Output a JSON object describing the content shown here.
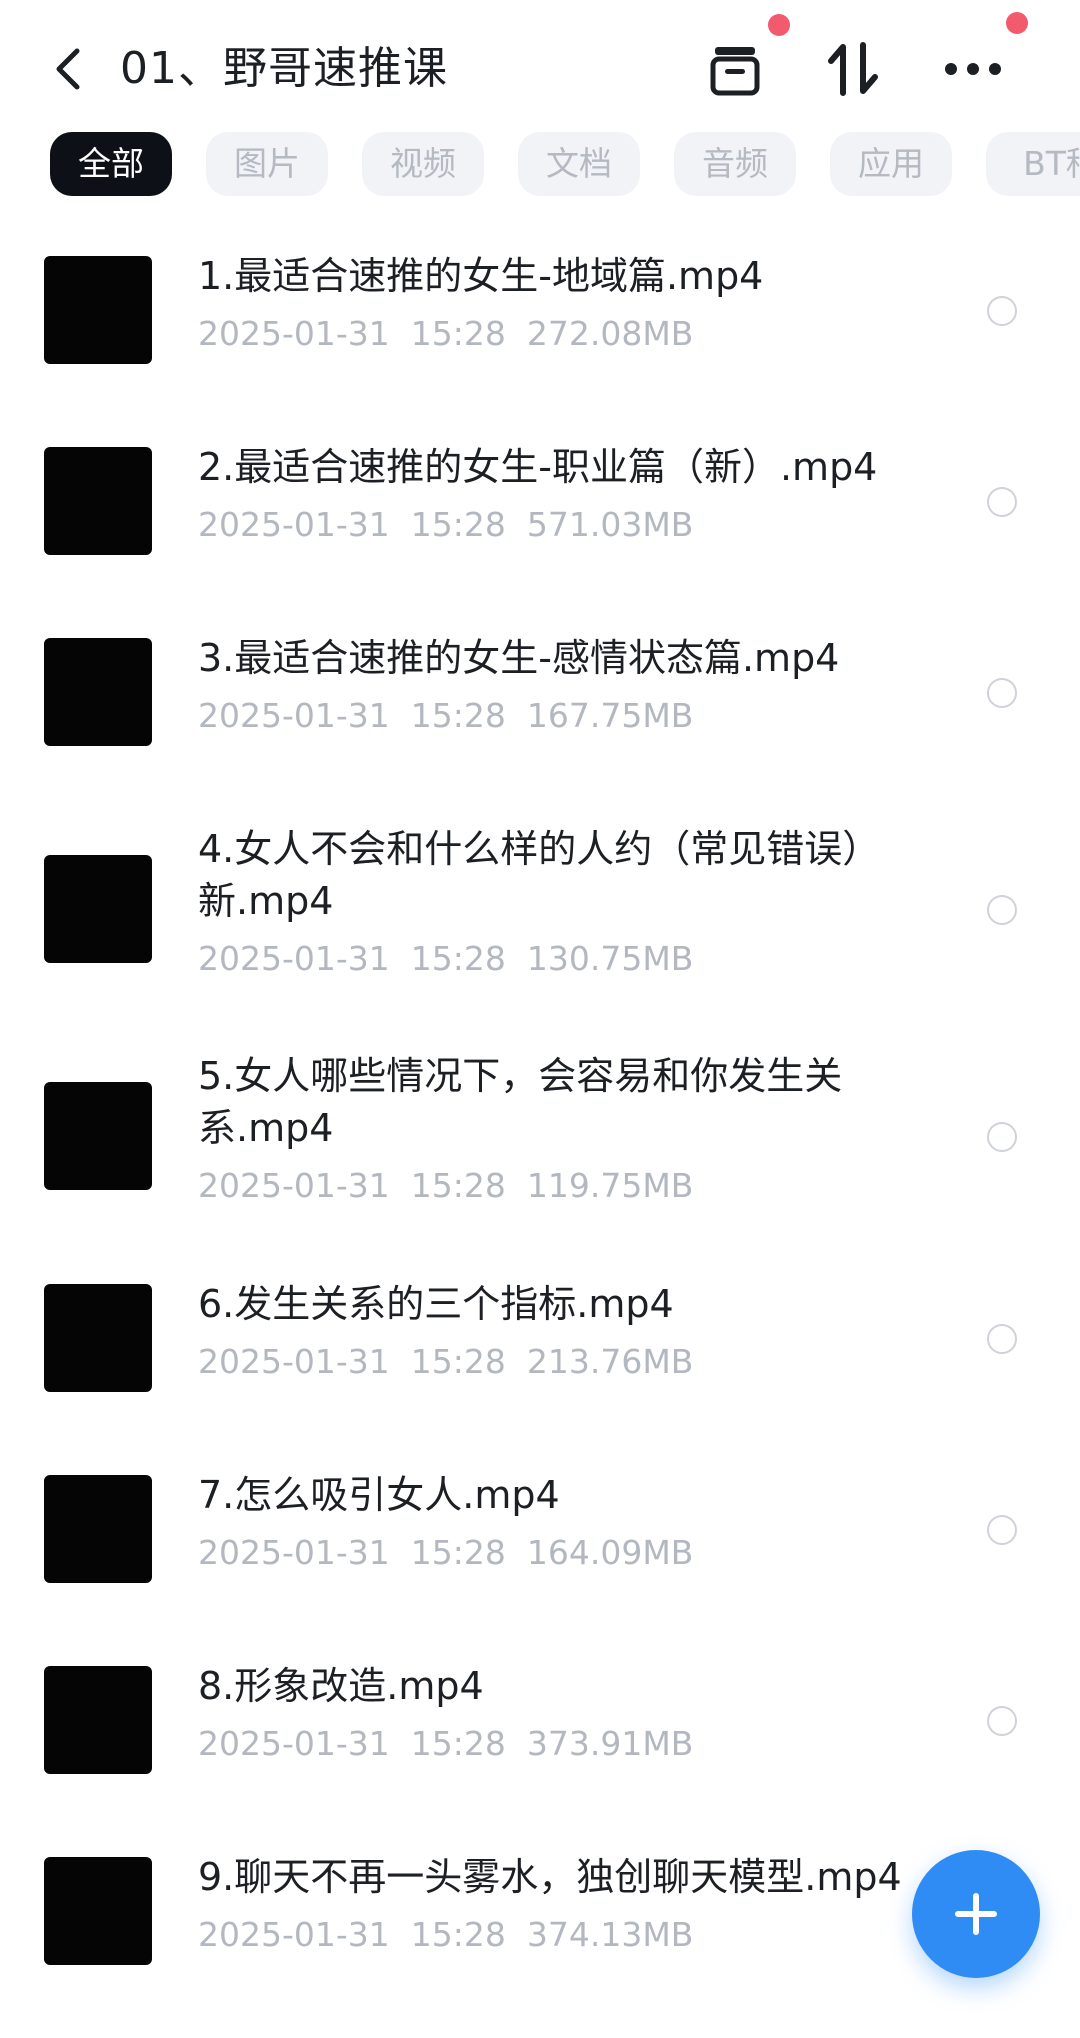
{
  "header": {
    "title": "01、野哥速推课",
    "icons": [
      "back-icon",
      "archive-icon",
      "sort-icon",
      "more-icon"
    ],
    "badge_color": "#f25a6d"
  },
  "filters": [
    "全部",
    "图片",
    "视频",
    "文档",
    "音频",
    "应用",
    "BT种"
  ],
  "files": [
    {
      "name": "1.最适合速推的女生-地域篇.mp4",
      "date": "2025-01-31",
      "time": "15:28",
      "size": "272.08MB"
    },
    {
      "name": "2.最适合速推的女生-职业篇（新）.mp4",
      "date": "2025-01-31",
      "time": "15:28",
      "size": "571.03MB"
    },
    {
      "name": "3.最适合速推的女生-感情状态篇.mp4",
      "date": "2025-01-31",
      "time": "15:28",
      "size": "167.75MB"
    },
    {
      "name": "4.女人不会和什么样的人约（常见错误）新.mp4",
      "date": "2025-01-31",
      "time": "15:28",
      "size": "130.75MB"
    },
    {
      "name": "5.女人哪些情况下，会容易和你发生关系.mp4",
      "date": "2025-01-31",
      "time": "15:28",
      "size": "119.75MB"
    },
    {
      "name": "6.发生关系的三个指标.mp4",
      "date": "2025-01-31",
      "time": "15:28",
      "size": "213.76MB"
    },
    {
      "name": "7.怎么吸引女人.mp4",
      "date": "2025-01-31",
      "time": "15:28",
      "size": "164.09MB"
    },
    {
      "name": "8.形象改造.mp4",
      "date": "2025-01-31",
      "time": "15:28",
      "size": "373.91MB"
    },
    {
      "name": "9.聊天不再一头雾水，独创聊天模型.mp4",
      "date": "2025-01-31",
      "time": "15:28",
      "size": "374.13MB"
    }
  ],
  "fab": {
    "icon": "plus-icon",
    "color": "#2f8cf5"
  }
}
